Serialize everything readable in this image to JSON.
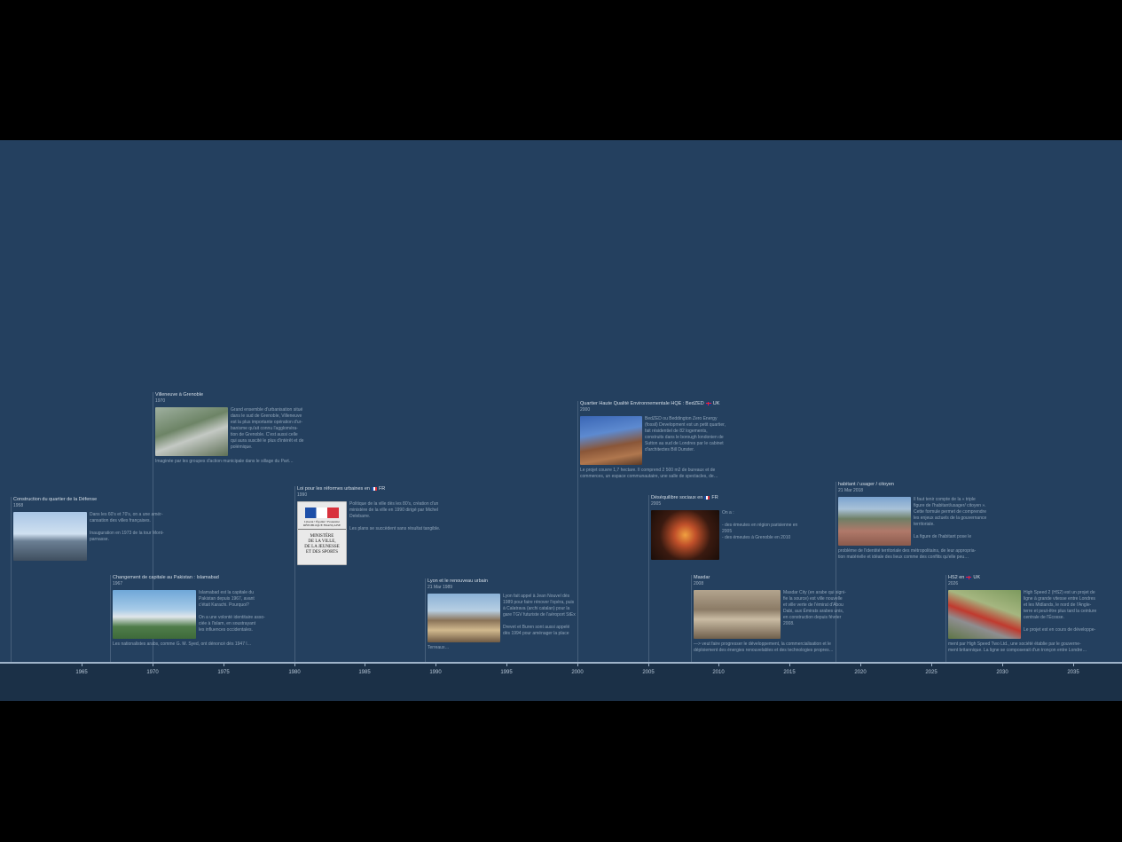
{
  "axis": {
    "years": [
      "1965",
      "1970",
      "1975",
      "1980",
      "1985",
      "1990",
      "1995",
      "2000",
      "2005",
      "2010",
      "2015",
      "2020",
      "2025",
      "2030",
      "2035"
    ]
  },
  "events": [
    {
      "title": "Construction du quartier de la Défense",
      "date": "1958",
      "text": [
        "Dans les 60's et 70's, on a une amér-",
        "cansation des villes françaises.",
        "",
        "Inauguration en 1973 de la tour Mont-",
        "parnasse."
      ],
      "foot": ""
    },
    {
      "title": "Villeneuve à Grenoble",
      "date": "1970",
      "text": [
        "Grand ensemble d'urbanisation situé",
        "dans le sud de Grenoble, Villeneuve",
        "est la plus importante opération d'ur-",
        "banisme qu'ait connu l'aggloméra-",
        "tion de Grenoble. C'est aussi celle",
        "qui aura suscité le plus d'intérêt et de",
        "polémique."
      ],
      "foot": "Imaginée par les groupes d'action municipale dans le sillage du Part…"
    },
    {
      "title": "Changement de capitale au Pakistan : Islamabad",
      "date": "1967",
      "text": [
        "Islamabad est la capitale du",
        "Pakistan depuis 1967, avant",
        "c'était Karachi. Pourquoi?",
        "",
        "On a une volonté identitaire asso-",
        "ciée à l'islam, en soustrayant",
        "les influences occidentales."
      ],
      "foot": "Les nationalistes arabs, comme G. M. Syed, ont dénoncé dès 1947 l…"
    },
    {
      "title": "Loi pour les réformes urbaines en",
      "flag": "FR",
      "date": "1990",
      "text": [
        "Politique de la ville dès les 80's, création d'un",
        "ministère de la ville en 1990 dirigé par Michel",
        "Delebarre.",
        "",
        "Les plans se succèdent sans résultat tangible."
      ],
      "foot": "",
      "ministry": {
        "rf": "Liberté • Égalité • Fraternité RÉPUBLIQUE FRANÇAISE",
        "lines": [
          "MINISTÈRE",
          "DE LA VILLE,",
          "DE LA JEUNESSE",
          "ET DES SPORTS"
        ]
      }
    },
    {
      "title": "Lyon et le renouveau urbain",
      "date": "21 Mar 1989",
      "text": [
        "Lyon fait appel à Jean Nouvel dès",
        "1989 pour faire rénover l'opéra, puis",
        "à Calatrava (archi catalan) pour la",
        "gare TGV futuriste de l'aéroport StEx",
        "",
        "Drevet et Buren sont aussi appelé",
        "dès 1994 pour aménager la place"
      ],
      "foot": "Terreaux…"
    },
    {
      "title": "Quartier Haute Qualité Environnementale HQE : BedZED",
      "flag": "UK",
      "date": "2000",
      "text": [
        "BedZED ou Beddington Zero Energy",
        "(fossil) Development est un petit quartier,",
        "fait résidentiel de 82 logements,",
        "construits dans le borough londonien de",
        "Sutton au sud de Londres par le cabinet",
        "d'architectes Bill Dunster."
      ],
      "foot": "Le projet couvre 1,7 hectare. Il comprend 2 500 m2 de bureaux et de",
      "foot2": "commerces, un espace communautaire, une salle de spectacles, de…"
    },
    {
      "title": "Déséquilibre sociaux en",
      "flag": "FR",
      "date": "2005",
      "text": [
        "On a :",
        "",
        "- des émeutes en région parisienne en",
        "2005",
        "- des émeutes à Grenoble en 2010"
      ],
      "foot": ""
    },
    {
      "title": "Masdar",
      "date": "2008",
      "text": [
        "Masdar City (en arabe qui signi-",
        "fie la source) est ville nouvelle",
        "et ville verte de l'émirat d'Abou",
        "Dabi, aux Émirats arabes unis,",
        "en construction depuis février",
        "2008."
      ],
      "foot": "—> veut faire progresser le développement, la commercialisation et le",
      "foot2": "déploiement des énergies renouvelables et des technologies propres…"
    },
    {
      "title": "habitant / usager / citoyen",
      "date": "21 Mar 2018",
      "text": [
        "Il faut tenir compte de la « triple",
        "figure de l'habitant/usager/ citoyen ».",
        "Cette formule permet de comprendre",
        "les enjeux actuels de la gouvernance",
        "territoriale.",
        "",
        "La figure de l'habitant pose le"
      ],
      "foot": "problème de l'identité territoriale des métropolitains, de leur appropria-",
      "foot2": "tion matérielle et idéale des lieux comme des conflits qu'elle peu…"
    },
    {
      "title": "HS2 en",
      "flag": "UK",
      "date": "2026",
      "text": [
        "High Speed 2 (HS2) est un projet de",
        "ligne à grande vitesse entre Londres",
        "et les Midlands, le nord de l'Angle-",
        "terre et peut-être plus tard la ceinture",
        "centrale de l'Écosse.",
        "",
        "Le projet est en cours de développe-"
      ],
      "foot": "ment par High Speed Two Ltd., une société établie par le gouverne-",
      "foot2": "ment britannique. La ligne se composerait d'un tronçon entre Londre…"
    }
  ]
}
